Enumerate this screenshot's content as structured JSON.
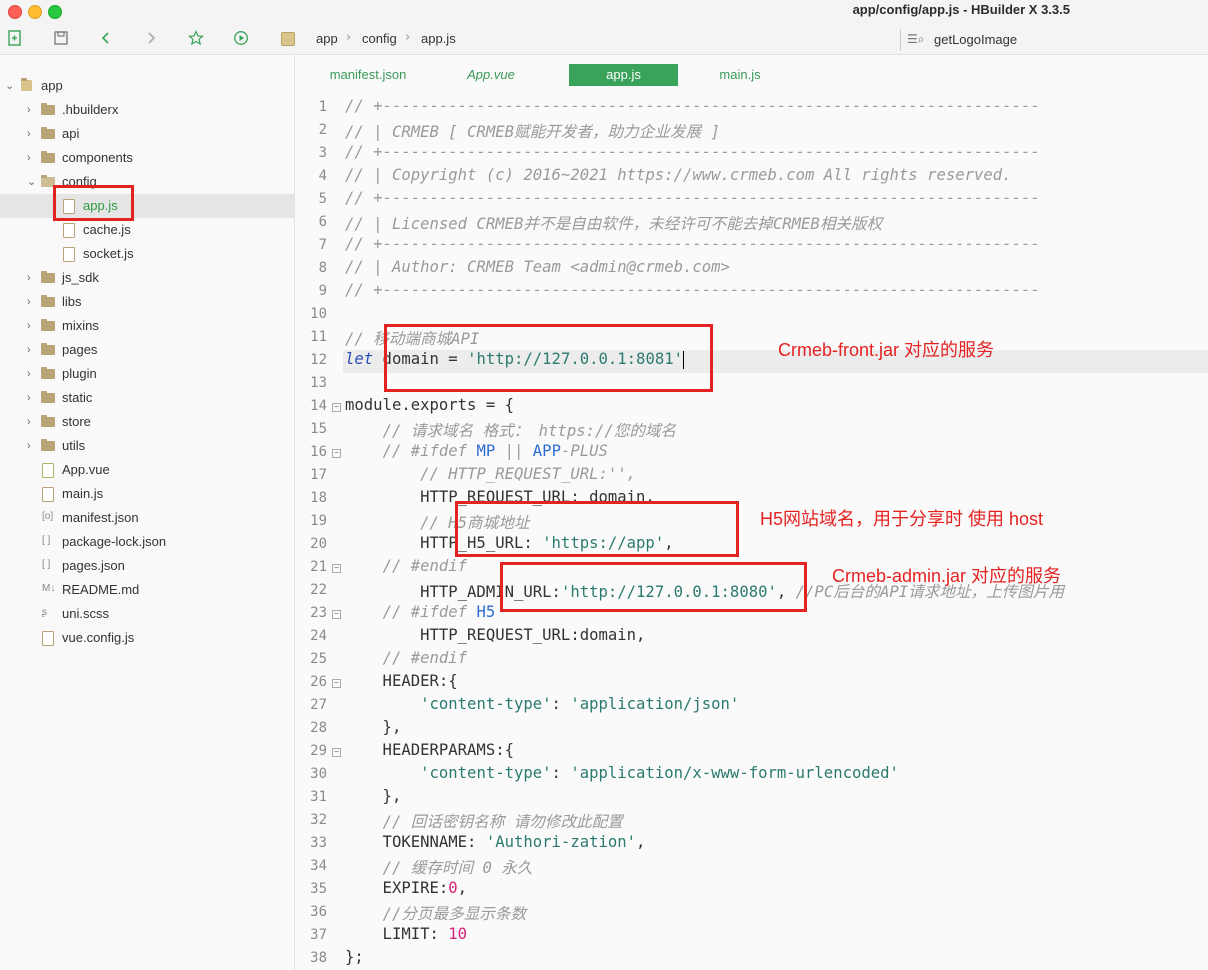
{
  "window": {
    "title": "app/config/app.js - HBuilder X 3.3.5"
  },
  "breadcrumb": {
    "items": [
      "app",
      "config",
      "app.js"
    ]
  },
  "search": {
    "value": "getLogoImage"
  },
  "sidebar": {
    "root": "app",
    "items": [
      {
        "label": ".hbuilderx",
        "type": "folder"
      },
      {
        "label": "api",
        "type": "folder"
      },
      {
        "label": "components",
        "type": "folder"
      },
      {
        "label": "config",
        "type": "folder-open"
      },
      {
        "label": "app.js",
        "type": "file",
        "selected": true
      },
      {
        "label": "cache.js",
        "type": "file"
      },
      {
        "label": "socket.js",
        "type": "file"
      },
      {
        "label": "js_sdk",
        "type": "folder"
      },
      {
        "label": "libs",
        "type": "folder"
      },
      {
        "label": "mixins",
        "type": "folder"
      },
      {
        "label": "pages",
        "type": "folder"
      },
      {
        "label": "plugin",
        "type": "folder"
      },
      {
        "label": "static",
        "type": "folder"
      },
      {
        "label": "store",
        "type": "folder"
      },
      {
        "label": "utils",
        "type": "folder"
      },
      {
        "label": "App.vue",
        "type": "vue"
      },
      {
        "label": "main.js",
        "type": "file"
      },
      {
        "label": "manifest.json",
        "type": "manifest"
      },
      {
        "label": "package-lock.json",
        "type": "json"
      },
      {
        "label": "pages.json",
        "type": "json"
      },
      {
        "label": "README.md",
        "type": "md"
      },
      {
        "label": "uni.scss",
        "type": "scss"
      },
      {
        "label": "vue.config.js",
        "type": "file"
      }
    ]
  },
  "tabs": [
    {
      "label": "manifest.json"
    },
    {
      "label": "App.vue"
    },
    {
      "label": "app.js",
      "active": true
    },
    {
      "label": "main.js"
    }
  ],
  "code": {
    "lines": [
      [
        {
          "t": "// +----------------------------------------------------------------------",
          "c": "cm"
        }
      ],
      [
        {
          "t": "// | CRMEB [ CRMEB赋能开发者，助力企业发展 ]",
          "c": "cm"
        }
      ],
      [
        {
          "t": "// +----------------------------------------------------------------------",
          "c": "cm"
        }
      ],
      [
        {
          "t": "// | Copyright (c) 2016~2021 https://www.crmeb.com All rights reserved.",
          "c": "cm"
        }
      ],
      [
        {
          "t": "// +----------------------------------------------------------------------",
          "c": "cm"
        }
      ],
      [
        {
          "t": "// | Licensed CRMEB并不是自由软件，未经许可不能去掉CRMEB相关版权",
          "c": "cm"
        }
      ],
      [
        {
          "t": "// +----------------------------------------------------------------------",
          "c": "cm"
        }
      ],
      [
        {
          "t": "// | Author: CRMEB Team <admin@crmeb.com>",
          "c": "cm"
        }
      ],
      [
        {
          "t": "// +----------------------------------------------------------------------",
          "c": "cm"
        }
      ],
      [],
      [
        {
          "t": "// 移动端商城API",
          "c": "cm"
        }
      ],
      [
        {
          "t": "let",
          "c": "kw"
        },
        {
          "t": " domain = "
        },
        {
          "t": "'http://127.0.0.1:8081'",
          "c": "str"
        }
      ],
      [],
      [
        {
          "t": "module.exports = {"
        }
      ],
      [
        {
          "t": "    "
        },
        {
          "t": "// 请求域名 格式： https://您的域名",
          "c": "cm"
        }
      ],
      [
        {
          "t": "    "
        },
        {
          "t": "// #ifdef ",
          "c": "cm"
        },
        {
          "t": "MP",
          "c": "mac"
        },
        {
          "t": " || ",
          "c": "cm"
        },
        {
          "t": "APP",
          "c": "mac"
        },
        {
          "t": "-PLUS",
          "c": "cm"
        }
      ],
      [
        {
          "t": "        "
        },
        {
          "t": "// HTTP_REQUEST_URL:'',",
          "c": "cm"
        }
      ],
      [
        {
          "t": "        HTTP_REQUEST_URL: domain,"
        }
      ],
      [
        {
          "t": "        "
        },
        {
          "t": "// H5商城地址",
          "c": "cm"
        }
      ],
      [
        {
          "t": "        HTTP_H5_URL: "
        },
        {
          "t": "'https://app'",
          "c": "str"
        },
        {
          "t": ","
        }
      ],
      [
        {
          "t": "    "
        },
        {
          "t": "// #endif",
          "c": "cm"
        }
      ],
      [
        {
          "t": "        HTTP_ADMIN_URL:"
        },
        {
          "t": "'http://127.0.0.1:8080'",
          "c": "str"
        },
        {
          "t": ", "
        },
        {
          "t": "//PC后台的API请求地址，上传图片用",
          "c": "cm"
        }
      ],
      [
        {
          "t": "    "
        },
        {
          "t": "// #ifdef ",
          "c": "cm"
        },
        {
          "t": "H5",
          "c": "mac"
        }
      ],
      [
        {
          "t": "        HTTP_REQUEST_URL:domain,"
        }
      ],
      [
        {
          "t": "    "
        },
        {
          "t": "// #endif",
          "c": "cm"
        }
      ],
      [
        {
          "t": "    HEADER:{"
        }
      ],
      [
        {
          "t": "        "
        },
        {
          "t": "'content-type'",
          "c": "str"
        },
        {
          "t": ": "
        },
        {
          "t": "'application/json'",
          "c": "str"
        }
      ],
      [
        {
          "t": "    },"
        }
      ],
      [
        {
          "t": "    HEADERPARAMS:{"
        }
      ],
      [
        {
          "t": "        "
        },
        {
          "t": "'content-type'",
          "c": "str"
        },
        {
          "t": ": "
        },
        {
          "t": "'application/x-www-form-urlencoded'",
          "c": "str"
        }
      ],
      [
        {
          "t": "    },"
        }
      ],
      [
        {
          "t": "    "
        },
        {
          "t": "// 回话密钥名称 请勿修改此配置",
          "c": "cm"
        }
      ],
      [
        {
          "t": "    TOKENNAME: "
        },
        {
          "t": "'Authori-zation'",
          "c": "str"
        },
        {
          "t": ","
        }
      ],
      [
        {
          "t": "    "
        },
        {
          "t": "// 缓存时间 0 永久",
          "c": "cm"
        }
      ],
      [
        {
          "t": "    EXPIRE:"
        },
        {
          "t": "0",
          "c": "num"
        },
        {
          "t": ","
        }
      ],
      [
        {
          "t": "    "
        },
        {
          "t": "//分页最多显示条数",
          "c": "cm"
        }
      ],
      [
        {
          "t": "    LIMIT: "
        },
        {
          "t": "10",
          "c": "num"
        }
      ],
      [
        {
          "t": "};"
        }
      ]
    ],
    "fold_lines": [
      14,
      16,
      21,
      23,
      26,
      29
    ],
    "highlight_line": 12
  },
  "annotations": {
    "front": "Crmeb-front.jar 对应的服务",
    "h5": "H5网站域名，用于分享时 使用 host",
    "admin": "Crmeb-admin.jar 对应的服务"
  },
  "colors": {
    "accent": "#3aa35a",
    "annotation": "#e42222"
  }
}
